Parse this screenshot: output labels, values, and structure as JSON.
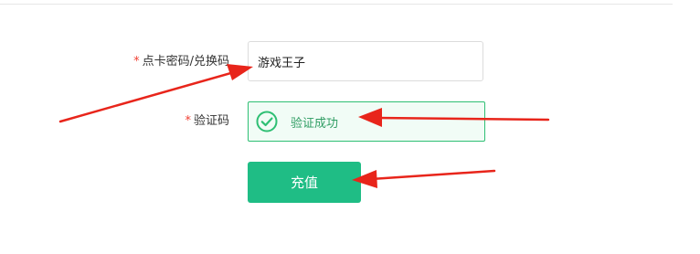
{
  "form": {
    "card_field": {
      "required_mark": "*",
      "label": "点卡密码/兑换码",
      "value": "游戏王子"
    },
    "verify_field": {
      "required_mark": "*",
      "label": "验证码",
      "status_text": "验证成功",
      "status_icon": "check-circle-icon"
    },
    "submit_label": "充值"
  },
  "colors": {
    "accent": "#1fbd85",
    "success": "#2fbf74",
    "required": "#f04134",
    "annotation_arrow": "#e8251b"
  }
}
